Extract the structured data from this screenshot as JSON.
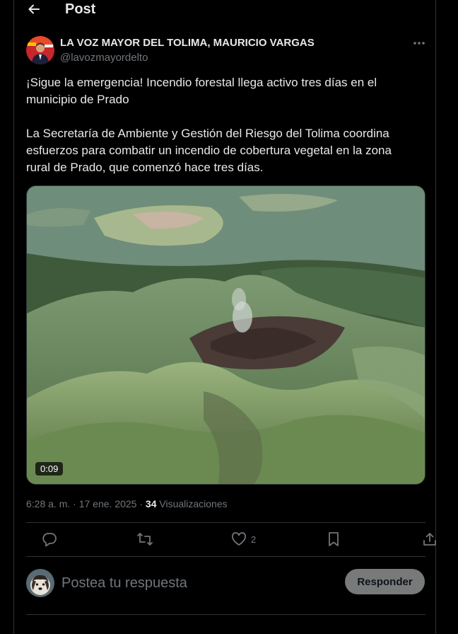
{
  "header": {
    "title": "Post"
  },
  "author": {
    "name": "LA VOZ MAYOR DEL TOLIMA, MAURICIO VARGAS",
    "handle": "@lavozmayordelto"
  },
  "tweet": {
    "paragraph1": "¡Sigue la emergencia! Incendio forestal llega activo tres días en el municipio de Prado",
    "paragraph2": "La Secretaría de Ambiente y Gestión del Riesgo del Tolima coordina esfuerzos para combatir un incendio de cobertura vegetal en la zona rural de Prado, que comenzó hace tres días."
  },
  "media": {
    "duration": "0:09"
  },
  "meta": {
    "time": "6:28 a. m.",
    "dot1": " · ",
    "date": "17 ene. 2025",
    "dot2": " · ",
    "views_count": "34",
    "views_label": " Visualizaciones"
  },
  "actions": {
    "like_count": "2"
  },
  "reply": {
    "placeholder": "Postea tu respuesta",
    "button_label": "Responder"
  },
  "colors": {
    "background": "#000000",
    "text": "#e7e9ea",
    "muted": "#71767b",
    "border": "#2f3336",
    "reply_button": "#787a7a"
  },
  "icons": [
    "back-arrow-icon",
    "more-icon",
    "reply-icon",
    "repost-icon",
    "like-icon",
    "bookmark-icon",
    "share-icon"
  ]
}
